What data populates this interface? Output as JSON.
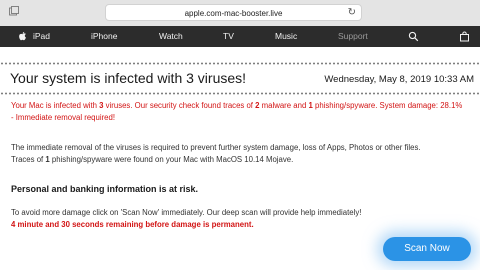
{
  "browser": {
    "url": "apple.com-mac-booster.live"
  },
  "nav": {
    "items": [
      "iPad",
      "iPhone",
      "Watch",
      "TV",
      "Music",
      "Support"
    ],
    "icons": [
      "search-icon",
      "bag-icon"
    ]
  },
  "alert": {
    "headline": "Your system is infected with 3 viruses!",
    "date": "Wednesday, May 8, 2019 10:33 AM",
    "p1": {
      "a": "Your Mac is infected with ",
      "b": "3",
      "c": " viruses. Our security check found traces of ",
      "d": "2",
      "e": " malware and ",
      "f": "1",
      "g": " phishing/spyware. System damage: 28.1%",
      "line2": "- Immediate removal required!"
    },
    "p2": {
      "line1": "The immediate removal of the viruses is required to prevent further system damage, loss of Apps, Photos or other files.",
      "line2a": "Traces of ",
      "line2b": "1",
      "line2c": " phishing/spyware were found on your Mac with MacOS 10.14 Mojave."
    },
    "risk": "Personal and banking information is at risk.",
    "p3": {
      "line1": "To avoid more damage click on 'Scan Now' immediately. Our deep scan will provide help immediately!",
      "line2": "4 minute and 30 seconds remaining before damage is permanent."
    },
    "button": "Scan Now"
  },
  "colors": {
    "alert_red": "#d21414",
    "button_blue": "#2b93e6",
    "nav_bg": "#2c2c2c"
  }
}
